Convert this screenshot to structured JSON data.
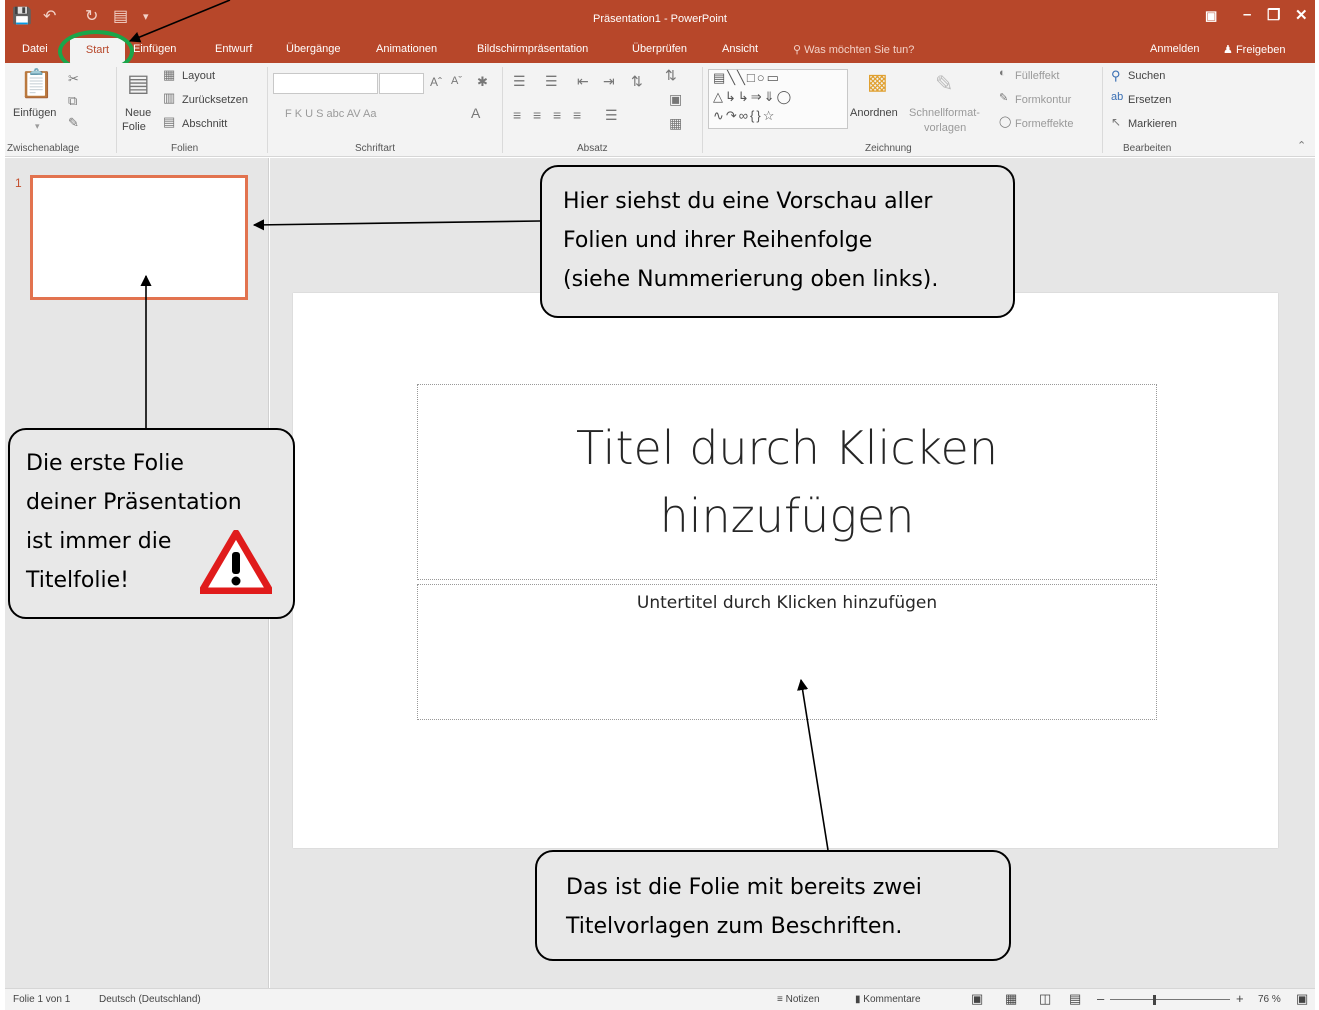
{
  "window": {
    "title": "Präsentation1 - PowerPoint"
  },
  "tabs": {
    "datei": "Datei",
    "start": "Start",
    "einfuegen": "Einfügen",
    "entwurf": "Entwurf",
    "uebergaenge": "Übergänge",
    "animationen": "Animationen",
    "bildschirm": "Bildschirmpräsentation",
    "ueberpruefen": "Überprüfen",
    "ansicht": "Ansicht",
    "tell_me": "Was möchten Sie tun?",
    "anmelden": "Anmelden",
    "freigeben": "Freigeben"
  },
  "ribbon": {
    "einfuegen": "Einfügen",
    "neue": "Neue",
    "folie": "Folie",
    "layout": "Layout",
    "zuruecksetzen": "Zurücksetzen",
    "abschnitt": "Abschnitt",
    "anordnen": "Anordnen",
    "schnellformat": "Schnellformat-",
    "vorlagen": "vorlagen",
    "fuelleffekt": "Fülleffekt",
    "formkontur": "Formkontur",
    "formeffekte": "Formeffekte",
    "suchen": "Suchen",
    "ersetzen": "Ersetzen",
    "markieren": "Markieren",
    "font_buttons": "F   K   U   S   abc   AV   Aa",
    "groups": {
      "zwischenablage": "Zwischenablage",
      "folien": "Folien",
      "schriftart": "Schriftart",
      "absatz": "Absatz",
      "zeichnung": "Zeichnung",
      "bearbeiten": "Bearbeiten"
    }
  },
  "thumbnails": {
    "number": "1"
  },
  "slide": {
    "title_placeholder": "Titel durch Klicken hinzufügen",
    "subtitle_placeholder": "Untertitel durch Klicken hinzufügen"
  },
  "statusbar": {
    "slide_info": "Folie 1 von 1",
    "language": "Deutsch (Deutschland)",
    "notizen": "Notizen",
    "kommentare": "Kommentare",
    "zoom": "76 %",
    "zoom_level": 0.76
  },
  "callouts": {
    "preview": [
      "Hier siehst du eine Vorschau aller",
      "Folien und ihrer Reihenfolge",
      "(siehe Nummerierung oben links)."
    ],
    "first_slide": [
      "Die erste Folie",
      "deiner Präsentation",
      "ist immer die",
      "Titelfolie!"
    ],
    "slide": [
      "Das ist die Folie mit bereits zwei",
      "Titelvorlagen zum Beschriften."
    ]
  },
  "colors": {
    "accent": "#b7472a",
    "highlight_ring": "#1aa64a",
    "thumb_border": "#e2734f",
    "warning": "#e01b1b"
  }
}
